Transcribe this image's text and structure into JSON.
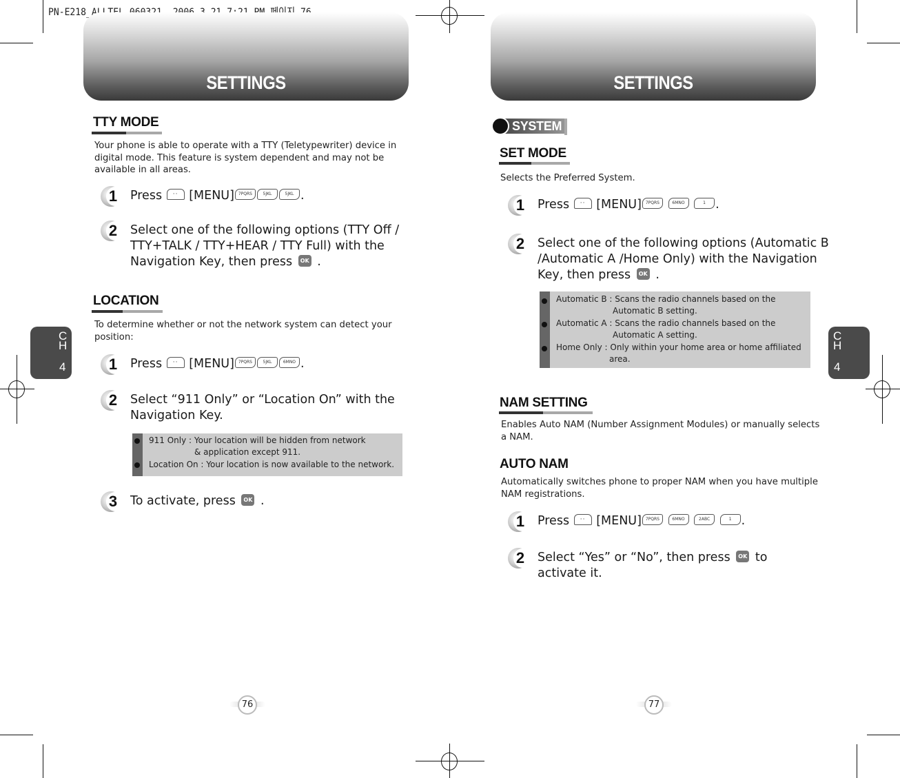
{
  "print_header": "PN-E218_ALLTEL_060321  2006.3.21 7:21 PM 페이지 76",
  "pages": {
    "left": {
      "banner_title": "SETTINGS",
      "chapter_tab": {
        "c": "C",
        "h": "H",
        "num": "4"
      },
      "page_number": "76",
      "tty_mode": {
        "heading": "TTY MODE",
        "description_lines": [
          "Your phone is able to operate with a TTY (Teletypewriter) device in",
          "digital mode. This feature is system dependent and may not be",
          "available in all areas."
        ],
        "step1": {
          "num": "1",
          "press": "Press",
          "menu": "[MENU]",
          "keys": [
            "7PQRS",
            "5JKL",
            "5JKL"
          ],
          "end": "."
        },
        "step2": {
          "num": "2",
          "lines": [
            "Select one of the following options (TTY Off /",
            "TTY+TALK / TTY+HEAR / TTY Full) with the",
            "Navigation Key, then press"
          ],
          "ok_label": "OK",
          "end": "."
        }
      },
      "location": {
        "heading": "LOCATION",
        "description_lines": [
          "To determine whether or not the network system can detect your",
          "position:"
        ],
        "step1": {
          "num": "1",
          "press": "Press",
          "menu": "[MENU]",
          "keys": [
            "7PQRS",
            "5JKL",
            "6MNO"
          ],
          "end": "."
        },
        "step2": {
          "num": "2",
          "lines": [
            "Select “911 Only” or “Location On” with the",
            "Navigation Key."
          ]
        },
        "notes": [
          {
            "label": "911 Only : Your location will be hidden from network",
            "cont": "& application except 911."
          },
          {
            "label": "Location On : Your location is now available to the network.",
            "cont": ""
          }
        ],
        "step3": {
          "num": "3",
          "text": "To activate, press",
          "ok_label": "OK",
          "end": "."
        }
      }
    },
    "right": {
      "banner_title": "SETTINGS",
      "chapter_tab": {
        "c": "C",
        "h": "H",
        "num": "4"
      },
      "page_number": "77",
      "system_label": "SYSTEM",
      "set_mode": {
        "heading": "SET MODE",
        "description": "Selects the Preferred System.",
        "step1": {
          "num": "1",
          "press": "Press",
          "menu": "[MENU]",
          "keys": [
            "7PQRS",
            "6MNO",
            "1"
          ],
          "end": "."
        },
        "step2": {
          "num": "2",
          "lines": [
            "Select one of the following options (Automatic B",
            "/Automatic A /Home Only) with the Navigation",
            "Key, then press"
          ],
          "ok_label": "OK",
          "end": "."
        },
        "notes": [
          {
            "label": "Automatic B : Scans the radio channels based on the",
            "cont": "Automatic B setting."
          },
          {
            "label": "Automatic A : Scans the radio channels based on the",
            "cont": "Automatic A setting."
          },
          {
            "label": "Home Only : Only within your home area or home affiliated",
            "cont": "area."
          }
        ]
      },
      "nam_setting": {
        "heading": "NAM SETTING",
        "description_lines": [
          "Enables Auto NAM (Number Assignment Modules) or manually selects",
          "a NAM."
        ]
      },
      "auto_nam": {
        "heading": "AUTO NAM",
        "description_lines": [
          "Automatically switches phone to proper NAM when you have multiple",
          "NAM registrations."
        ],
        "step1": {
          "num": "1",
          "press": "Press",
          "menu": "[MENU]",
          "keys": [
            "7PQRS",
            "6MNO",
            "2ABC",
            "1"
          ],
          "end": "."
        },
        "step2": {
          "num": "2",
          "text": "Select “Yes” or “No”, then press",
          "ok_label": "OK",
          "after": "to",
          "line2": "activate it."
        }
      }
    }
  }
}
